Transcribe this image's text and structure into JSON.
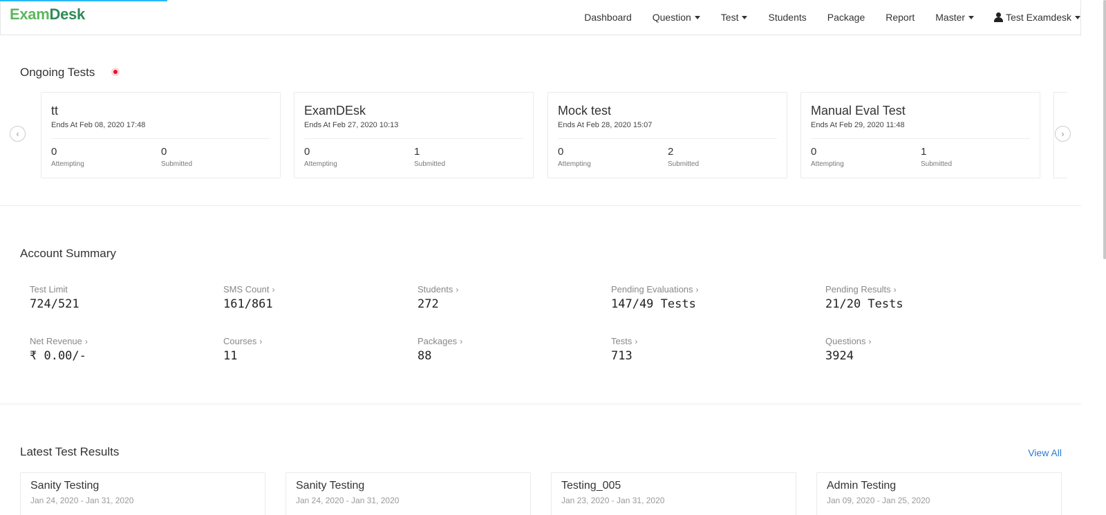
{
  "brand": {
    "part1": "Exam",
    "part2": "Desk"
  },
  "nav": {
    "items": [
      {
        "label": "Dashboard",
        "dropdown": false
      },
      {
        "label": "Question",
        "dropdown": true
      },
      {
        "label": "Test",
        "dropdown": true
      },
      {
        "label": "Students",
        "dropdown": false
      },
      {
        "label": "Package",
        "dropdown": false
      },
      {
        "label": "Report",
        "dropdown": false
      },
      {
        "label": "Master",
        "dropdown": true
      }
    ],
    "user": "Test Examdesk"
  },
  "ongoing": {
    "title": "Ongoing Tests",
    "attempting_label": "Attempting",
    "submitted_label": "Submitted",
    "tests": [
      {
        "name": "tt",
        "ends": "Ends At Feb 08, 2020 17:48",
        "attempting": "0",
        "submitted": "0"
      },
      {
        "name": "ExamDEsk",
        "ends": "Ends At Feb 27, 2020 10:13",
        "attempting": "0",
        "submitted": "1"
      },
      {
        "name": "Mock test",
        "ends": "Ends At Feb 28, 2020 15:07",
        "attempting": "0",
        "submitted": "2"
      },
      {
        "name": "Manual Eval Test",
        "ends": "Ends At Feb 29, 2020 11:48",
        "attempting": "0",
        "submitted": "1"
      }
    ]
  },
  "summary": {
    "title": "Account Summary",
    "stats": [
      {
        "label": "Test Limit",
        "value": "724/521",
        "link": false
      },
      {
        "label": "SMS Count",
        "value": "161/861",
        "link": true
      },
      {
        "label": "Students",
        "value": "272",
        "link": true
      },
      {
        "label": "Pending Evaluations",
        "value": "147/49 Tests",
        "link": true
      },
      {
        "label": "Pending Results",
        "value": "21/20 Tests",
        "link": true
      },
      {
        "label": "Net Revenue",
        "value": "₹ 0.00/-",
        "link": true
      },
      {
        "label": "Courses",
        "value": "11",
        "link": true
      },
      {
        "label": "Packages",
        "value": "88",
        "link": true
      },
      {
        "label": "Tests",
        "value": "713",
        "link": true
      },
      {
        "label": "Questions",
        "value": "3924",
        "link": true
      }
    ]
  },
  "results": {
    "title": "Latest Test Results",
    "view_all": "View All",
    "items": [
      {
        "name": "Sanity Testing",
        "dates": "Jan 24, 2020 - Jan 31, 2020"
      },
      {
        "name": "Sanity Testing",
        "dates": "Jan 24, 2020 - Jan 31, 2020"
      },
      {
        "name": "Testing_005",
        "dates": "Jan 23, 2020 - Jan 31, 2020"
      },
      {
        "name": "Admin Testing",
        "dates": "Jan 09, 2020 - Jan 25, 2020"
      }
    ]
  },
  "colors": {
    "brand_green": "#5cb85c",
    "live_red": "#e8112d",
    "link_blue": "#2a7bd4"
  }
}
